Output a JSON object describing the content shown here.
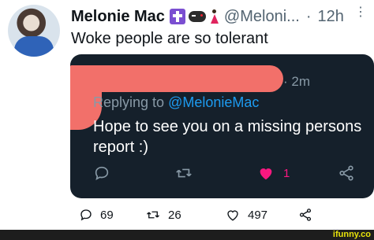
{
  "tweet": {
    "author_name": "Melonie Mac",
    "handle": "@Meloni...",
    "separator": "·",
    "time": "12h",
    "text": "Woke people are so tolerant",
    "stats": {
      "replies": "69",
      "retweets": "26",
      "likes": "497"
    }
  },
  "embedded_reply": {
    "time": "· 2m",
    "replying_prefix": "Replying to",
    "replying_to": "@MelonieMac",
    "line1": "Hope to see you on a missing persons",
    "line2": "report :)",
    "like_count": "1"
  },
  "watermark": "ifunny.co",
  "colors": {
    "link": "#1d9bf0",
    "like": "#f91880",
    "redaction": "#f2706a",
    "dark_bg": "#15202b"
  },
  "icons": [
    "more-icon",
    "reply-icon",
    "retweet-icon",
    "like-icon",
    "share-icon"
  ]
}
